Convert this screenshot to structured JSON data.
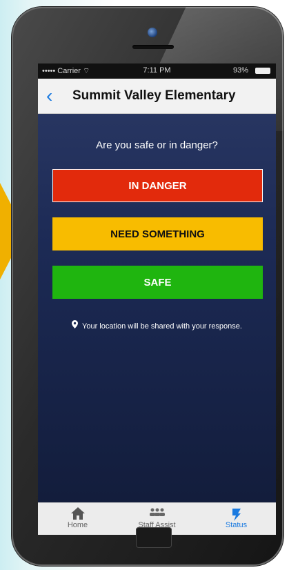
{
  "status_bar": {
    "carrier": "••••• Carrier ⌔",
    "time": "7:11 PM",
    "battery": "93%"
  },
  "nav": {
    "back_icon": "‹",
    "title": "Summit Valley Elementary"
  },
  "prompt": "Are you safe or in danger?",
  "buttons": {
    "danger": "IN DANGER",
    "need": "NEED SOMETHING",
    "safe": "SAFE"
  },
  "location_note": "Your location will be shared with your response.",
  "tabs": [
    {
      "label": "Home",
      "icon": "home-icon"
    },
    {
      "label": "Staff Assist",
      "icon": "people-icon"
    },
    {
      "label": "Status",
      "icon": "status-icon"
    }
  ],
  "colors": {
    "danger": "#e22a0c",
    "need": "#f8bc00",
    "safe": "#1fb50f",
    "accent": "#1a7ae0"
  }
}
